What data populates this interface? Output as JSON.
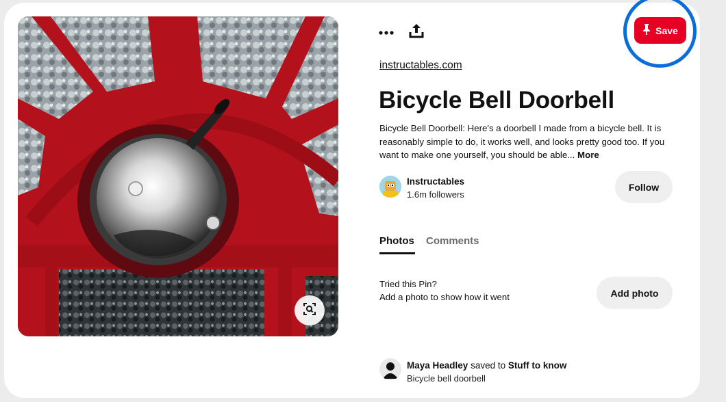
{
  "pin": {
    "source": "instructables.com",
    "title": "Bicycle Bell Doorbell",
    "description": "Bicycle Bell Doorbell: Here's a doorbell I made from a bicycle bell. It is reasonably simple to do, it works well, and looks pretty good too. If you want to make one yourself, you should be able...",
    "more_label": "More"
  },
  "toolbar": {
    "more_icon": "ellipsis-icon",
    "share_icon": "share-upload-icon",
    "save_label": "Save",
    "save_color": "#e60023",
    "focus_ring_color": "#0a6ed9"
  },
  "creator": {
    "name": "Instructables",
    "followers": "1.6m followers",
    "follow_label": "Follow"
  },
  "tabs": [
    {
      "label": "Photos",
      "active": true
    },
    {
      "label": "Comments",
      "active": false
    }
  ],
  "tried": {
    "title": "Tried this Pin?",
    "subtitle": "Add a photo to show how it went",
    "button_label": "Add photo"
  },
  "activity": {
    "user": "Maya Headley",
    "action": " saved to ",
    "board": "Stuff to know",
    "note": "Bicycle bell doorbell"
  },
  "image": {
    "lens_icon": "visual-search-icon"
  }
}
